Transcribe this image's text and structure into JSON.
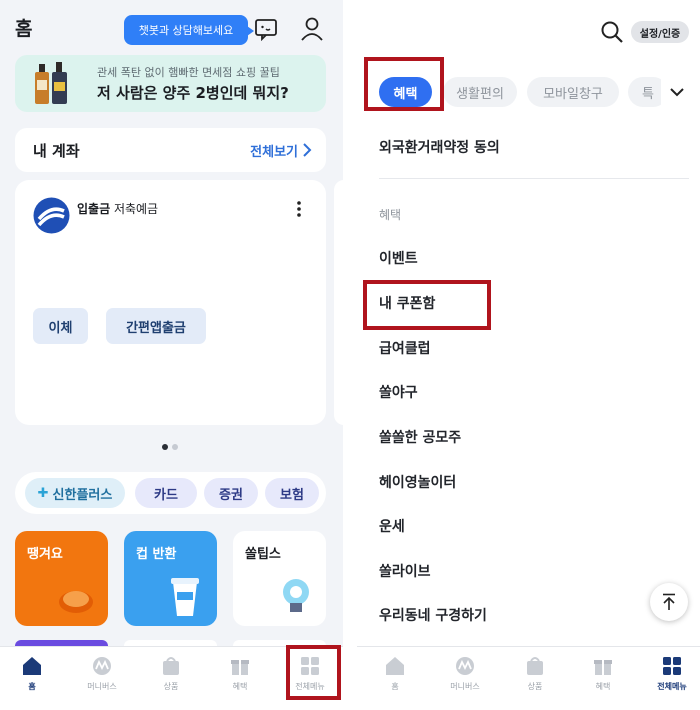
{
  "left": {
    "title": "홈",
    "chatbot_tooltip": "챗봇과 상담해보세요",
    "promo": {
      "subtitle": "관세 폭탄 없이 햄빠한 면세점 쇼핑 꿀팁",
      "title": "저 사람은 양주 2병인데 뭐지?"
    },
    "accounts": {
      "title": "내 계좌",
      "see_all": "전체보기",
      "card": {
        "name_bold": "입출금",
        "name_rest": " 저축예금",
        "buttons": [
          "이체",
          "간편앱출금"
        ]
      },
      "page_dots": {
        "count": 2,
        "active": 1
      }
    },
    "chips": [
      {
        "label": "신한플러스"
      },
      {
        "label": "카드"
      },
      {
        "label": "증권"
      },
      {
        "label": "보험"
      }
    ],
    "tiles": [
      {
        "label": "땡겨요",
        "bg": "#f2760f",
        "fg": "#ffffff"
      },
      {
        "label": "컵 반환",
        "bg": "#3aa0ef",
        "fg": "#ffffff"
      },
      {
        "label": "쏠팁스",
        "bg": "#ffffff",
        "fg": "#1b1d22"
      }
    ],
    "tabbar": [
      {
        "label": "홈",
        "icon": "home-icon"
      },
      {
        "label": "머니버스",
        "icon": "moneyverse-icon"
      },
      {
        "label": "상품",
        "icon": "bag-icon"
      },
      {
        "label": "혜택",
        "icon": "gift-icon"
      },
      {
        "label": "전체메뉴",
        "icon": "grid-menu-icon"
      }
    ],
    "active_tab": "홈"
  },
  "right": {
    "auth_button": "설정/인증",
    "categories": [
      {
        "label": "혜택"
      },
      {
        "label": "생활편의"
      },
      {
        "label": "모바일창구"
      },
      {
        "label": "특"
      }
    ],
    "active_category": "혜택",
    "top_item": "외국환거래약정 동의",
    "section_label": "혜택",
    "items": [
      "이벤트",
      "내 쿠폰함",
      "급여클럽",
      "쏠야구",
      "쏠쏠한 공모주",
      "헤이영놀이터",
      "운세",
      "쏠라이브",
      "우리동네 구경하기"
    ],
    "tabbar": [
      {
        "label": "홈",
        "icon": "home-icon"
      },
      {
        "label": "머니버스",
        "icon": "moneyverse-icon"
      },
      {
        "label": "상품",
        "icon": "bag-icon"
      },
      {
        "label": "혜택",
        "icon": "gift-icon"
      },
      {
        "label": "전체메뉴",
        "icon": "grid-menu-icon"
      }
    ],
    "active_tab": "전체메뉴"
  },
  "colors": {
    "accent": "#2f6ff1",
    "highlight_box": "#b0141d",
    "promo_bg": "#dcf3ee"
  }
}
